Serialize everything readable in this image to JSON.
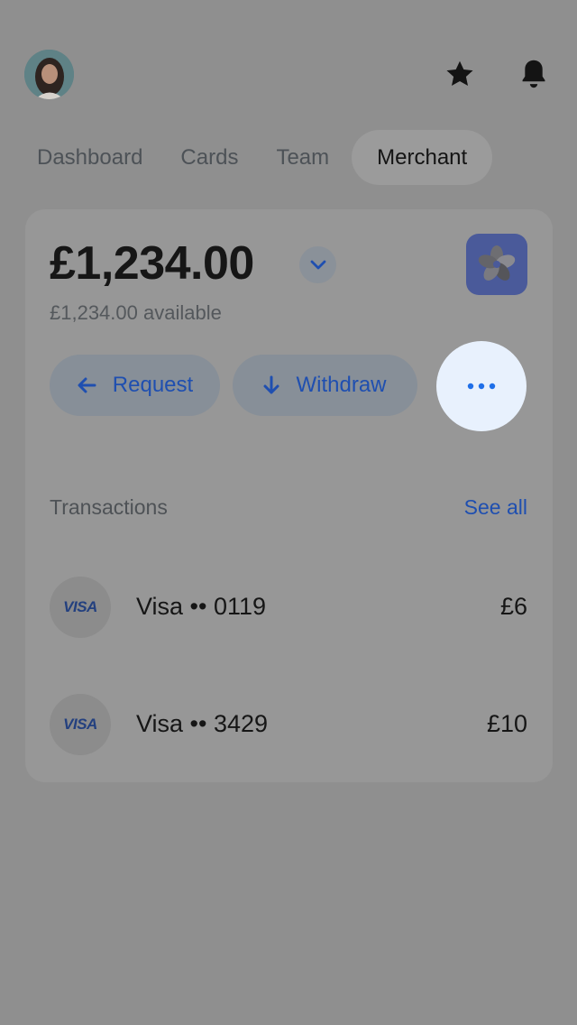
{
  "header": {
    "avatar_icon": "avatar",
    "favorite_icon": "star-icon",
    "notifications_icon": "bell-icon"
  },
  "tabs": [
    {
      "label": "Dashboard",
      "active": false
    },
    {
      "label": "Cards",
      "active": false
    },
    {
      "label": "Team",
      "active": false
    },
    {
      "label": "Merchant",
      "active": true
    }
  ],
  "account": {
    "balance": "£1,234.00",
    "available": "£1,234.00 available",
    "balance_toggle_icon": "chevron-down-icon",
    "app_icon": "pinwheel-logo-icon"
  },
  "actions": {
    "request_label": "Request",
    "withdraw_label": "Withdraw",
    "more_icon": "more-horizontal-icon"
  },
  "transactions": {
    "title": "Transactions",
    "see_all": "See all",
    "items": [
      {
        "brand": "VISA",
        "name": "Visa •• 0119",
        "amount": "£6"
      },
      {
        "brand": "VISA",
        "name": "Visa •• 3429",
        "amount": "£10"
      }
    ]
  },
  "colors": {
    "overlay_background": "#8f8f8f",
    "accent_blue": "#1f4fb0",
    "highlight_button": "#e8f1fd"
  }
}
